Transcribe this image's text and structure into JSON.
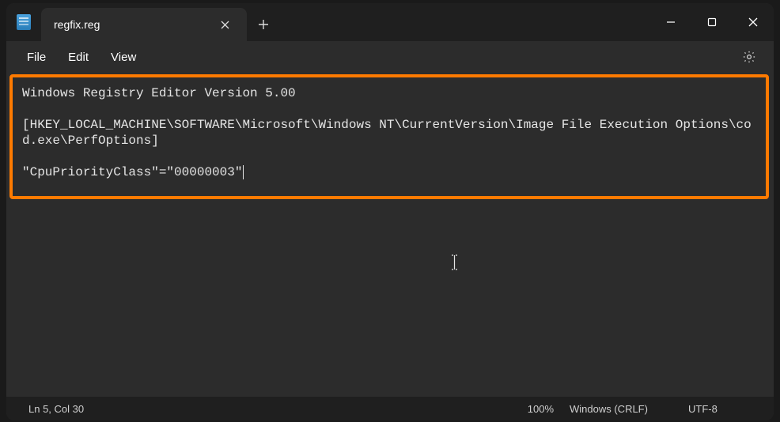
{
  "tab": {
    "title": "regfix.reg"
  },
  "menu": {
    "file": "File",
    "edit": "Edit",
    "view": "View"
  },
  "editor": {
    "line1": "Windows Registry Editor Version 5.00",
    "line2": "",
    "line3": "[HKEY_LOCAL_MACHINE\\SOFTWARE\\Microsoft\\Windows NT\\CurrentVersion\\Image File Execution Options\\cod.exe\\PerfOptions]",
    "line4": "",
    "line5": "\"CpuPriorityClass\"=\"00000003\""
  },
  "status": {
    "position": "Ln 5, Col 30",
    "zoom": "100%",
    "eol": "Windows (CRLF)",
    "encoding": "UTF-8"
  }
}
